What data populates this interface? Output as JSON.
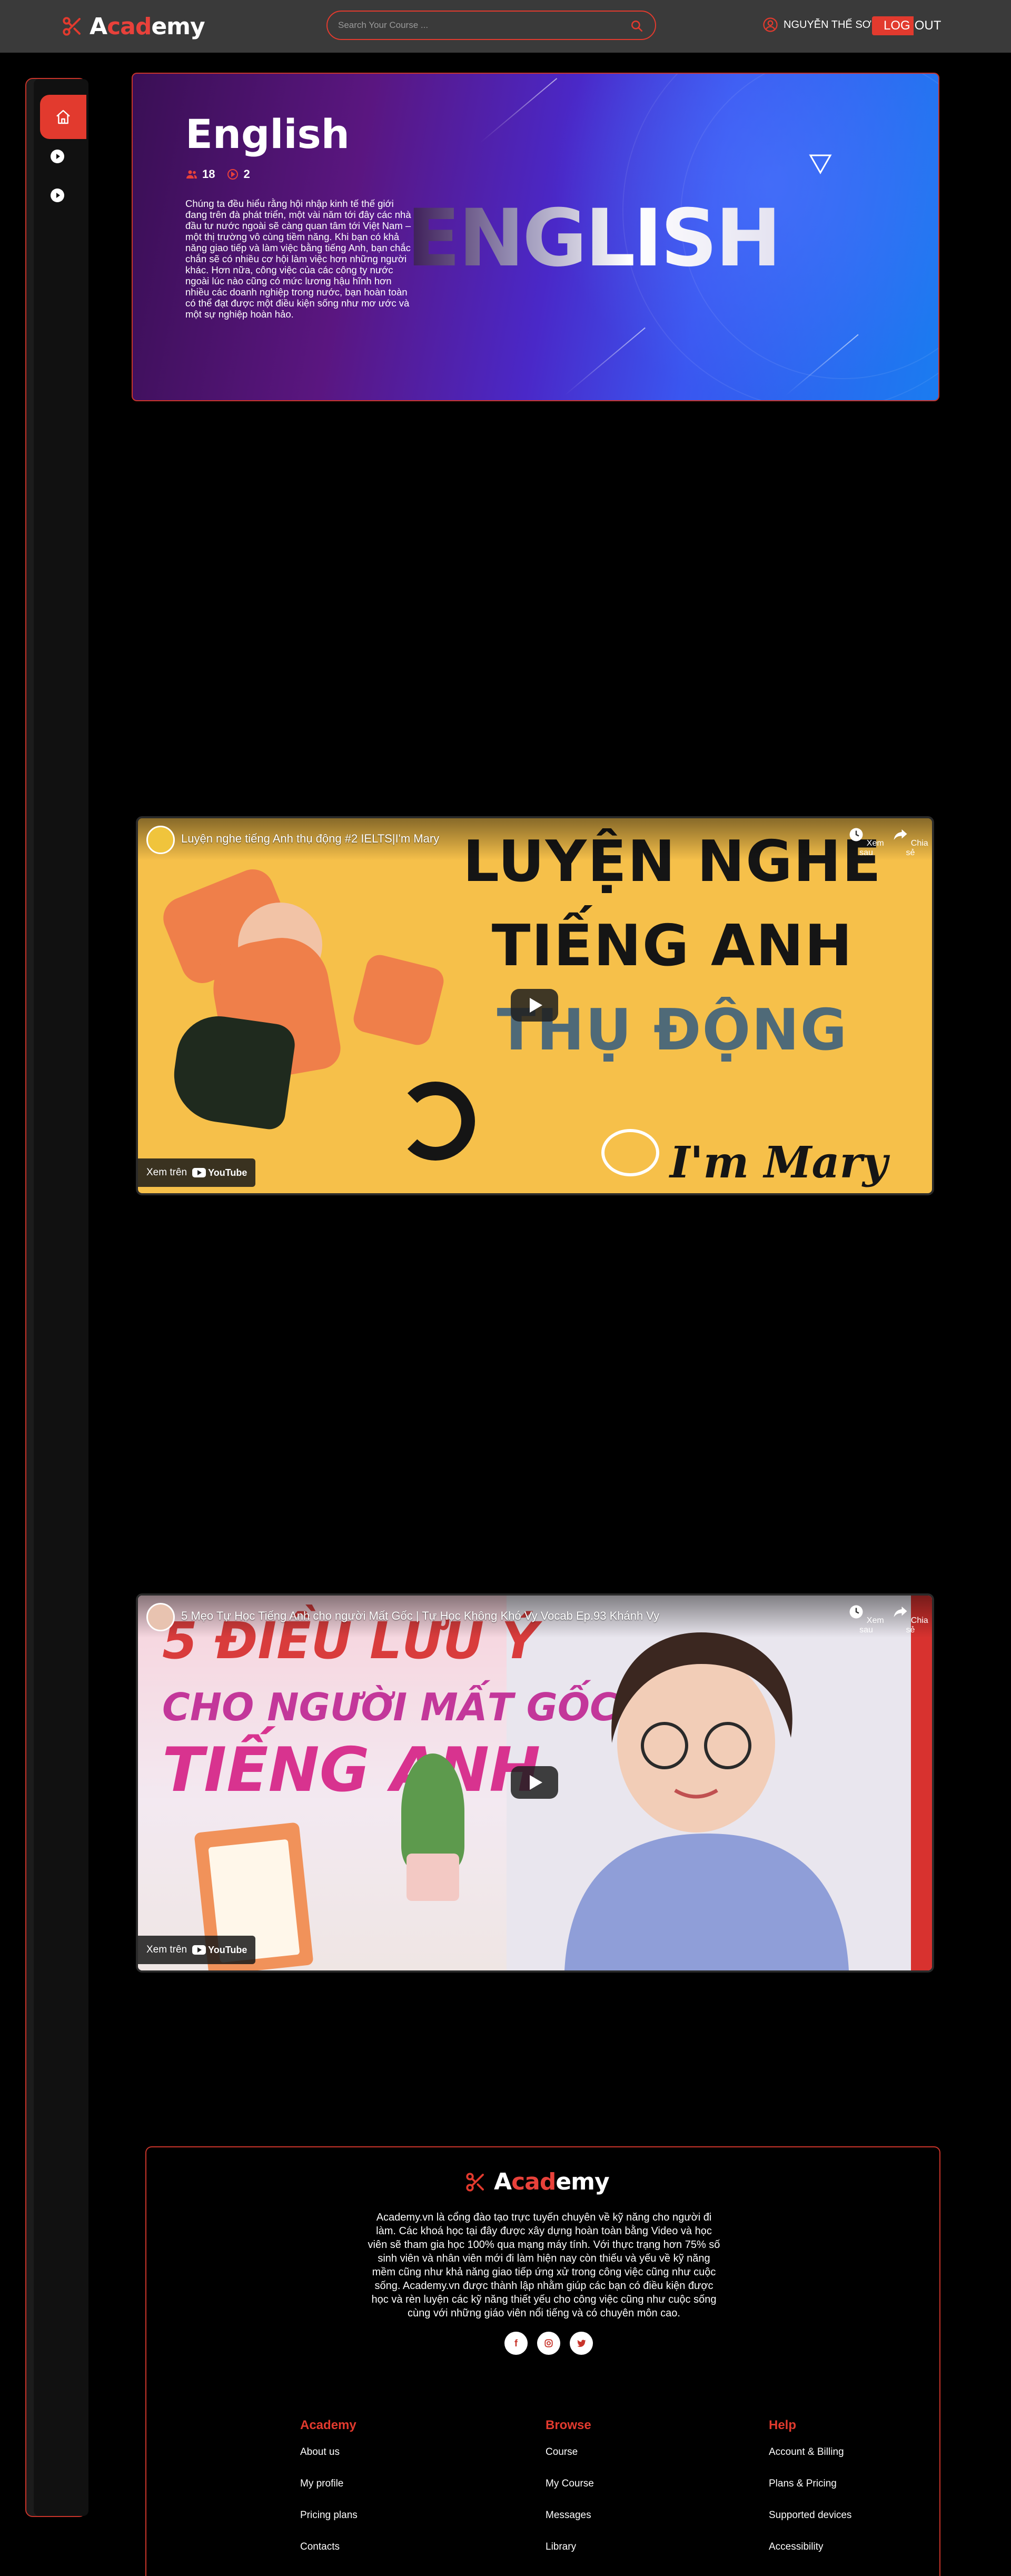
{
  "brand": {
    "part1": "A",
    "part2": "cad",
    "part3": "emy",
    "accent": "#e23a2e"
  },
  "header": {
    "search_placeholder": "Search Your Course ...",
    "user_name": "NGUYỄN THẾ SƠN",
    "logout_red": "LOG",
    "logout_plain": "OUT"
  },
  "sidebar": {
    "items": [
      "home-icon",
      "play-icon",
      "play-icon"
    ]
  },
  "course": {
    "title": "English",
    "students": "18",
    "videos": "2",
    "banner_word": "ENGLISH",
    "description": "Chúng ta đều hiểu rằng hội nhập kinh tế thế giới đang trên đà phát triển, một vài năm tới đây các nhà đầu tư nước ngoài sẽ càng quan tâm tới Việt Nam – một thị trường vô cùng tiềm năng. Khi bạn có khả năng giao tiếp và làm việc bằng tiếng Anh, bạn chắc chắn sẽ có nhiều cơ hội làm việc hơn những người khác. Hơn nữa, công việc của các công ty nước ngoài lúc nào cũng có mức lương hậu hĩnh hơn nhiều các doanh nghiệp trong nước, bạn hoàn toàn có thể đạt được một điều kiện sống như mơ ước và một sự nghiệp hoàn hảo."
  },
  "videos": [
    {
      "title": "Luyện nghe tiếng Anh thụ động #2 IELTS|I'm Mary",
      "watch_later": "Xem sau",
      "share": "Chia sẻ",
      "watch_on": "Xem trên",
      "youtube": "YouTube",
      "thumb_lines": [
        "LUYỆN NGHE",
        "TIẾNG ANH",
        "THỤ ĐỘNG"
      ],
      "thumb_script": "I'm Mary"
    },
    {
      "title": "5 Mẹo Tự Học Tiếng Anh cho người Mất Gốc | Tự Học Không Khó Vy Vocab Ep.93 Khánh Vy",
      "watch_later": "Xem sau",
      "share": "Chia sẻ",
      "watch_on": "Xem trên",
      "youtube": "YouTube",
      "thumb_lines": [
        "5 ĐIỀU LƯU Ý",
        "CHO NGƯỜI MẤT GỐC",
        "TIẾNG ANH"
      ]
    }
  ],
  "footer": {
    "description": "Academy.vn là cổng đào tạo trực tuyến chuyên về kỹ năng cho người đi làm. Các khoá học tại đây được xây dựng hoàn toàn bằng Video và học viên sẽ tham gia học 100% qua mạng máy tính. Với thực trạng hơn 75% số sinh viên và nhân viên mới đi làm hiện nay còn thiếu và yếu về kỹ năng mềm cũng như khả năng giao tiếp ứng xử trong công việc cũng như cuộc sống. Academy.vn được thành lập nhằm giúp các bạn có điều kiện được học và rèn luyện các kỹ năng thiết yếu cho công việc cũng như cuộc sống cùng với những giáo viên nổi tiếng và có chuyên môn cao.",
    "social": [
      "facebook-icon",
      "instagram-icon",
      "twitter-icon"
    ],
    "columns": [
      {
        "heading": "Academy",
        "links": [
          "About us",
          "My profile",
          "Pricing plans",
          "Contacts"
        ]
      },
      {
        "heading": "Browse",
        "links": [
          "Course",
          "My Course",
          "Messages",
          "Library"
        ]
      },
      {
        "heading": "Help",
        "links": [
          "Account & Billing",
          "Plans & Pricing",
          "Supported devices",
          "Accessibility"
        ]
      }
    ]
  }
}
